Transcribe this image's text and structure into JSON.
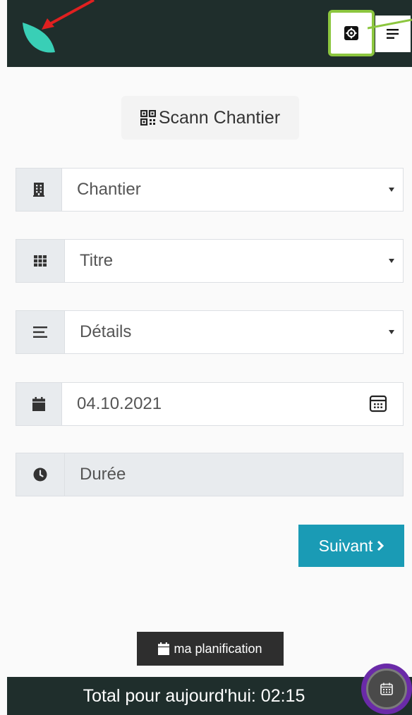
{
  "scan": {
    "label": "Scann Chantier"
  },
  "form": {
    "chantier": {
      "placeholder": "Chantier"
    },
    "titre": {
      "placeholder": "Titre"
    },
    "details": {
      "placeholder": "Détails"
    },
    "date": {
      "value": "04.10.2021"
    },
    "duree": {
      "placeholder": "Durée"
    }
  },
  "actions": {
    "next_label": "Suivant",
    "planning_label": "ma planification"
  },
  "footer": {
    "total_text": "Total pour aujourd'hui: 02:15"
  },
  "colors": {
    "header_bg": "#1f2e2c",
    "accent": "#1a9bb5",
    "logo": "#39cfb6",
    "highlight_green": "#8cc63f",
    "highlight_purple": "#6a2aa8",
    "annotation_red": "#e02020"
  },
  "icons": {
    "logo": "leaf-logo",
    "settings": "gear-icon",
    "menu": "menu-lines-icon",
    "scan": "qr-code-icon",
    "chantier": "building-icon",
    "titre": "grid-icon",
    "details": "align-left-icon",
    "date": "calendar-icon",
    "duree": "clock-icon",
    "next": "chevron-right-icon",
    "planning": "calendar-icon",
    "fab": "calendar-icon"
  }
}
